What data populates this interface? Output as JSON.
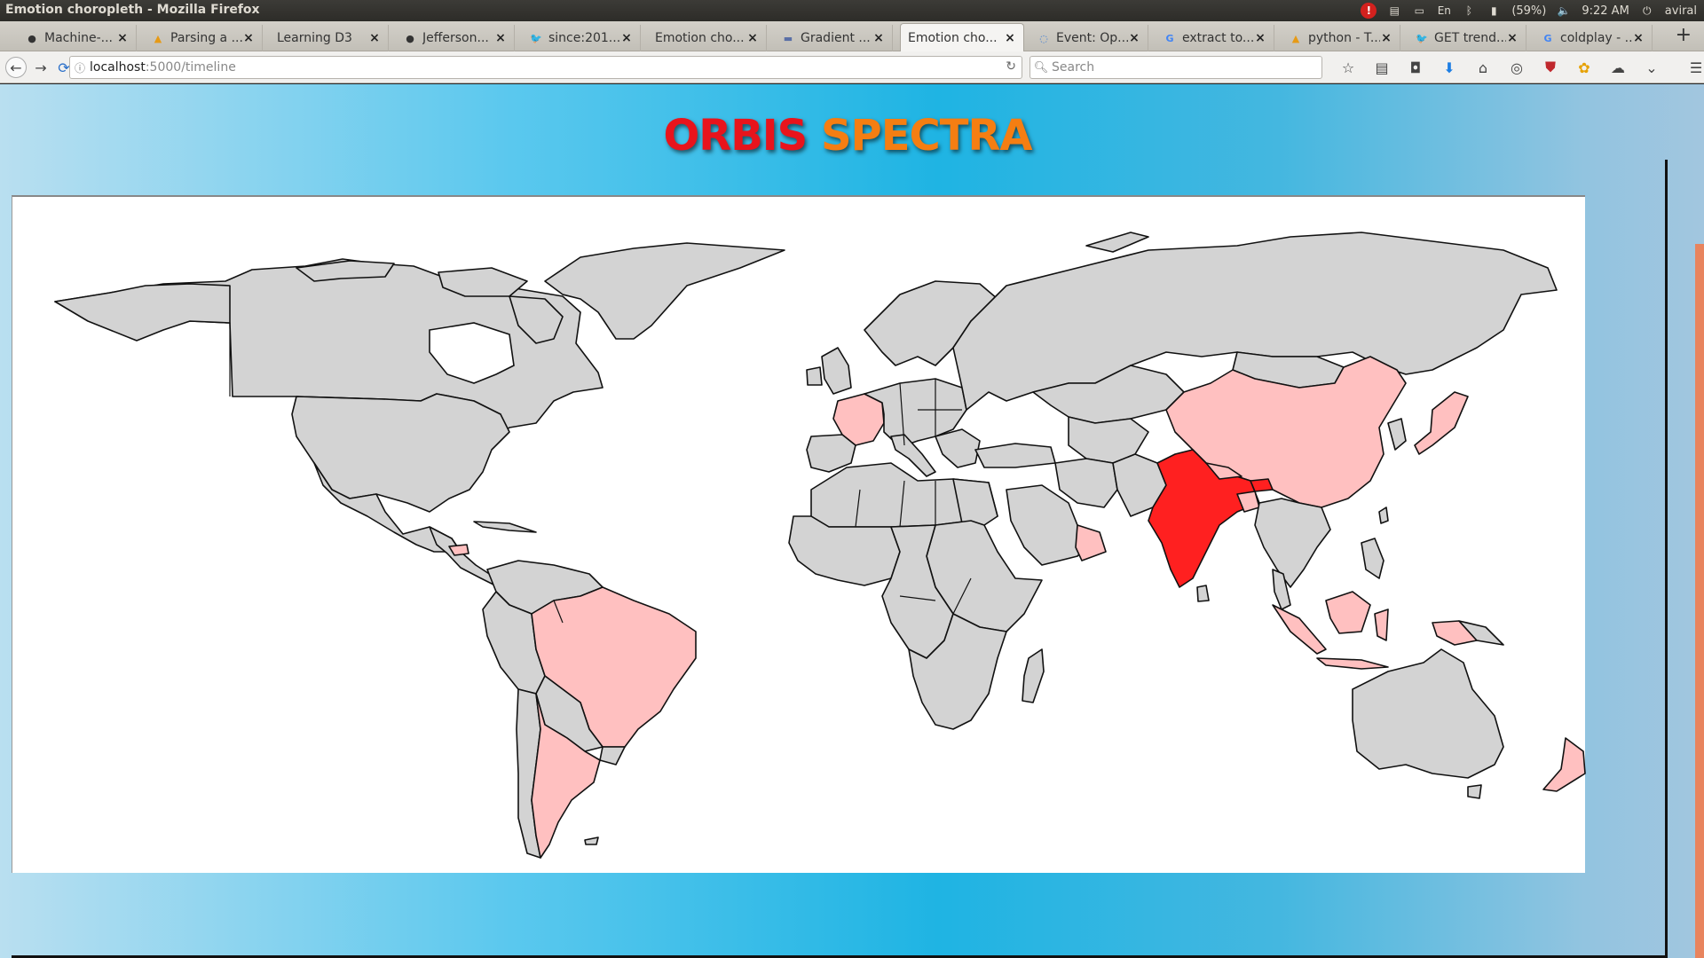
{
  "window": {
    "title": "Emotion choropleth - Mozilla Firefox"
  },
  "tray": {
    "battery": "(59%)",
    "time": "9:22 AM",
    "user": "aviral",
    "keyboard": "En",
    "alert": "!"
  },
  "tabs": [
    {
      "label": "Machine-...",
      "icon": "github-icon"
    },
    {
      "label": "Parsing a ...",
      "icon": "stackoverflow-icon"
    },
    {
      "label": "Learning D3",
      "icon": "none"
    },
    {
      "label": "Jefferson...",
      "icon": "github-icon"
    },
    {
      "label": "since:201...",
      "icon": "twitter-icon"
    },
    {
      "label": "Emotion cho...",
      "icon": "none"
    },
    {
      "label": "Gradient ...",
      "icon": "page-icon"
    },
    {
      "label": "Emotion cho...",
      "icon": "none",
      "active": true
    },
    {
      "label": "Event: Op...",
      "icon": "loading-icon"
    },
    {
      "label": "extract to...",
      "icon": "google-icon"
    },
    {
      "label": "python - T...",
      "icon": "stackoverflow-icon"
    },
    {
      "label": "GET trend...",
      "icon": "twitter-icon"
    },
    {
      "label": "coldplay - ...",
      "icon": "google-icon"
    }
  ],
  "url": {
    "host": "localhost",
    "path": ":5000/timeline"
  },
  "search": {
    "placeholder": "Search"
  },
  "page": {
    "title_part1": "ORBIS",
    "title_part2": "SPECTRA"
  },
  "map": {
    "colors": {
      "neutral": "#d3d3d3",
      "low": "#ffc0c0",
      "high": "#ff2020",
      "ocean": "#ffffff"
    },
    "highlighted_high": [
      "India",
      "Bhutan"
    ],
    "highlighted_low": [
      "France",
      "China",
      "Brazil",
      "Argentina",
      "Japan",
      "Indonesia",
      "Oman",
      "Honduras",
      "New Zealand",
      "Papua New Guinea"
    ]
  }
}
